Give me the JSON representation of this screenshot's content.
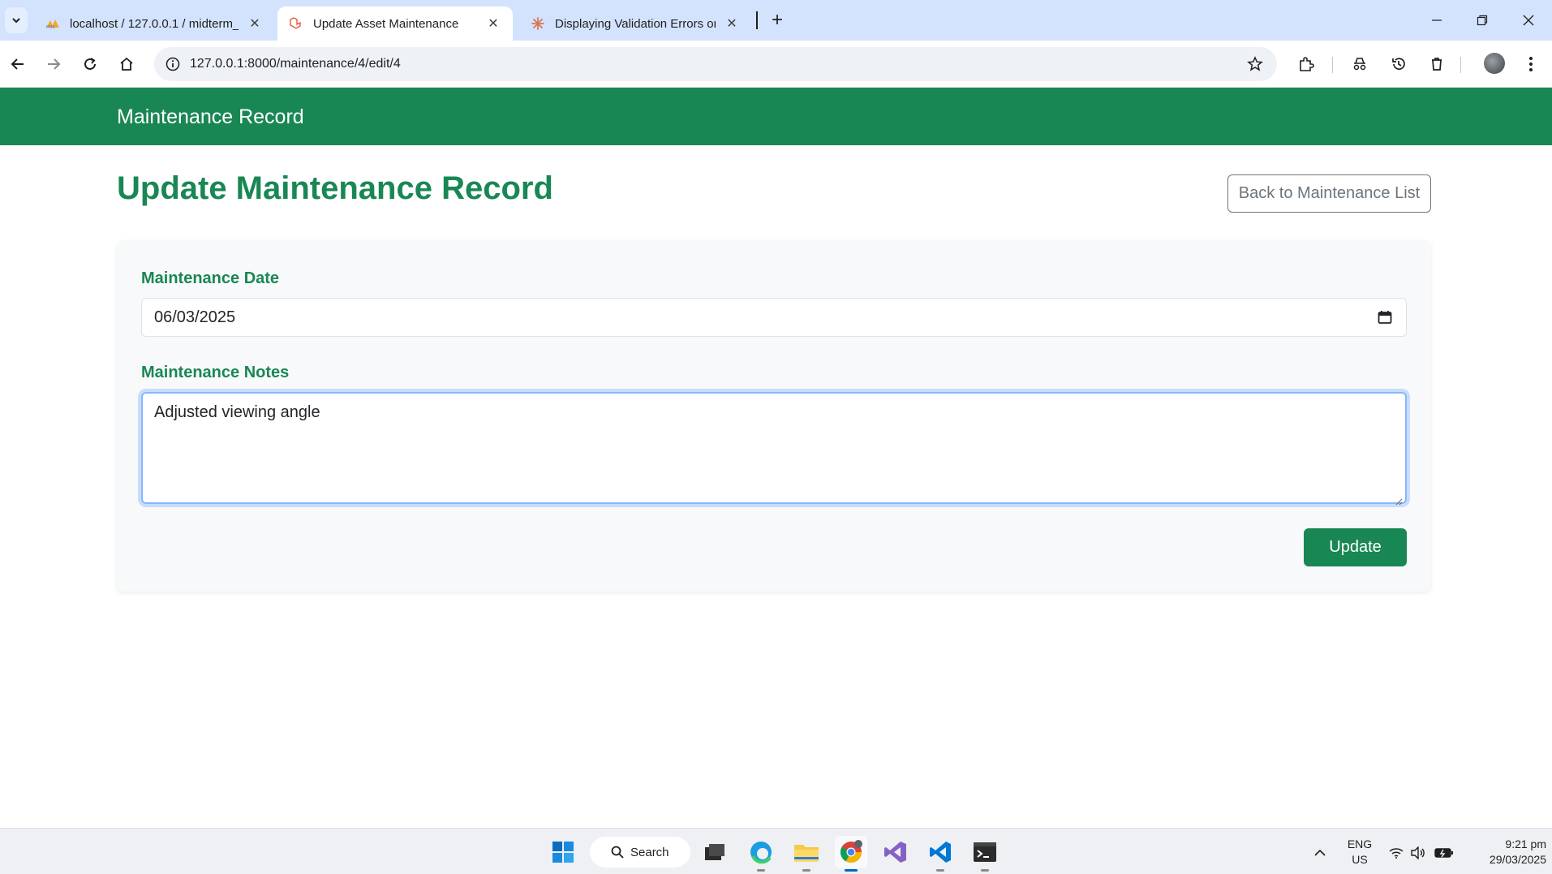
{
  "browser": {
    "tabs": [
      {
        "title": "localhost / 127.0.0.1 / midterm_",
        "favicon": "phpmyadmin-icon"
      },
      {
        "title": "Update Asset Maintenance",
        "favicon": "laravel-icon",
        "active": true
      },
      {
        "title": "Displaying Validation Errors on",
        "favicon": "claude-icon"
      }
    ],
    "url": "127.0.0.1:8000/maintenance/4/edit/4"
  },
  "navbar": {
    "brand": "Maintenance Record"
  },
  "page": {
    "title": "Update Maintenance Record",
    "back_button": "Back to Maintenance List"
  },
  "form": {
    "date_label": "Maintenance Date",
    "date_value": "06/03/2025",
    "notes_label": "Maintenance Notes",
    "notes_value": "Adjusted viewing angle",
    "submit_label": "Update"
  },
  "taskbar": {
    "search_label": "Search",
    "lang_top": "ENG",
    "lang_bottom": "US",
    "time": "9:21 pm",
    "date": "29/03/2025"
  },
  "colors": {
    "primary": "#198754",
    "tabstrip": "#d3e3fd",
    "focus": "#86b7fe"
  }
}
